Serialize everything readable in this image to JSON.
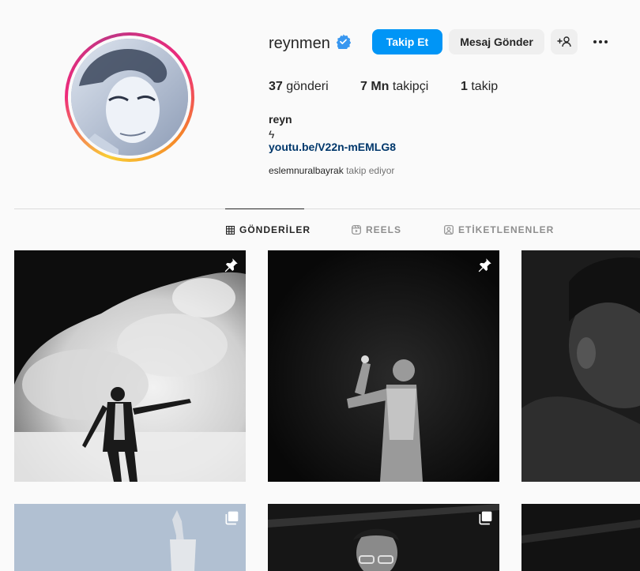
{
  "profile": {
    "username": "reynmen",
    "verified": true,
    "follow_label": "Takip Et",
    "message_label": "Mesaj Gönder",
    "add_user_label": "+",
    "stats": {
      "posts_count": "37",
      "posts_label": "gönderi",
      "followers_count": "7 Mn",
      "followers_label": "takipçi",
      "following_count": "1",
      "following_label": "takip"
    },
    "bio": {
      "name": "reyn",
      "line": "ϟ",
      "link": "youtu.be/V22n-mEMLG8"
    },
    "followed_by": {
      "name": "eslemnuralbayrak",
      "suffix": "takip ediyor"
    }
  },
  "tabs": [
    {
      "label": "GÖNDERİLER",
      "icon": "grid-icon",
      "active": true
    },
    {
      "label": "REELS",
      "icon": "reels-icon",
      "active": false
    },
    {
      "label": "ETİKETLENENLER",
      "icon": "tagged-icon",
      "active": false
    }
  ],
  "posts": [
    {
      "badge": "pin-icon"
    },
    {
      "badge": "pin-icon"
    },
    {
      "badge": ""
    },
    {
      "badge": "multi-image-icon"
    },
    {
      "badge": "multi-image-icon"
    },
    {
      "badge": ""
    }
  ],
  "colors": {
    "accent": "#0095f6",
    "link": "#00376b",
    "verified": "#3897f0"
  }
}
